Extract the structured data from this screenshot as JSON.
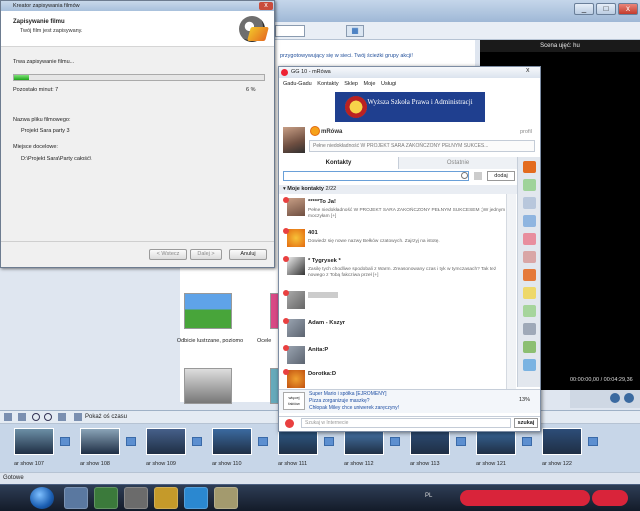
{
  "wizard": {
    "title": "Kreator zapisywania filmów",
    "heading": "Zapisywanie filmu",
    "subheading": "Twój film jest zapisywany.",
    "progress_label": "Trwa zapisywanie filmu...",
    "progress_value": 0.06,
    "remaining_label": "Pozostało minut: 7",
    "percent_text": "6 %",
    "filename_label": "Nazwa pliku filmowego:",
    "filename": "Projekt Sara party 3",
    "location_label": "Miejsce docelowe:",
    "location": "D:\\Projekt Sara\\Party całość\\",
    "back_button": "< Wstecz",
    "next_button": "Dalej >",
    "cancel_button": "Anuluj",
    "close_glyph": "x"
  },
  "moviemaker": {
    "combo_value": "",
    "help_text": "przygotowywujący się w sieci. Twój ścieżki grupy akcji!",
    "pane_thumb_label_1": "Odbicie lustrzane, poziomo",
    "pane_thumb_label_2": "Ocele",
    "preview_title": "Scena ujęć: hu",
    "preview_time": "00:00:00,00 / 00:04:29,36",
    "timeline_label": "Pokaż oś czasu",
    "storyboard": [
      {
        "label": "ar show 107"
      },
      {
        "label": "ar show 108"
      },
      {
        "label": "ar show 109"
      },
      {
        "label": "ar show 110"
      },
      {
        "label": "ar show 111"
      },
      {
        "label": "ar show 112"
      },
      {
        "label": "ar show 113"
      },
      {
        "label": "ar show 121"
      },
      {
        "label": "ar show 122"
      }
    ],
    "status": "Gotowe"
  },
  "gg": {
    "title": "GG 10 - mRówa",
    "menu": [
      "Gadu-Gadu",
      "Kontakty",
      "Sklep",
      "Moje",
      "Usługi"
    ],
    "banner": "Wyższa Szkoła Prawa i Administracji",
    "nick": "mRówa",
    "profile_link": "profil",
    "description": "Pełne niedokładność W PROJEKT SARA ZAKOŃCZONY PEŁNYM SUKCES...",
    "tab_contacts": "Kontakty",
    "tab_recent": "Ostatnie",
    "add_button": "dodaj",
    "group_label": "Moje kontakty",
    "group_count": "2/22",
    "contacts": [
      {
        "name": "*****To Ja!",
        "desc": "Pełne niedokładność W PROJEKT SARA ZAKOŃCZONY PEŁNYM SUKCESEM ;)W jednym moczyłam [+]"
      },
      {
        "name": "401",
        "desc": "Dowiedz się nowe nazwy Bełków czatowych. Zajrzyj na istotę."
      },
      {
        "name": "* Tygrysek *",
        "desc": "Zasilę tych chodliwe spodobali z Warm. Zreasonowany czas i tyk w tymczasach? Tak też nowego z Tobą fakcziwa przeł [+]"
      },
      {
        "name": "",
        "desc": ""
      },
      {
        "name": "Adam - Kszyr",
        "desc": ""
      },
      {
        "name": "Anita:P",
        "desc": ""
      },
      {
        "name": "Dorotka:D",
        "desc": ""
      }
    ],
    "news": [
      "Super Mario i spółka [EJROMENY]",
      "Pizza zorganizuje maszkę?",
      "Chłopak Miley chce uniwerek zaręczyny!"
    ],
    "news_icon_label": "więcej faktów",
    "news_count": "13%",
    "chat_placeholder": "Szukaj w Internecie",
    "chat_button": "szukaj",
    "close_glyph": "x"
  },
  "taskbar": {
    "lang": "PL"
  },
  "colors": {
    "accent": "#1b5fb3",
    "progress": "#1fa51a",
    "gg_red": "#e94040",
    "banner": "#1f3f8f"
  }
}
